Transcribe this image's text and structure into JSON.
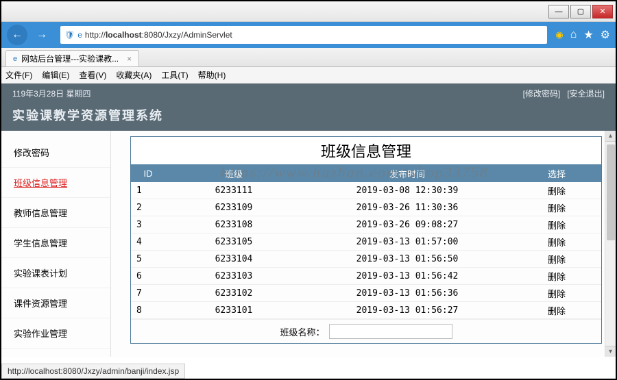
{
  "window": {
    "min": "—",
    "max": "▢",
    "close": "✕"
  },
  "nav": {
    "back": "←",
    "fwd": "→",
    "url_prefix": "http://",
    "url_host": "localhost",
    "url_rest": ":8080/Jxzy/AdminServlet"
  },
  "tab": {
    "title": "网站后台管理---实验课教..."
  },
  "menu": [
    "文件(F)",
    "编辑(E)",
    "查看(V)",
    "收藏夹(A)",
    "工具(T)",
    "帮助(H)"
  ],
  "header": {
    "date": "119年3月28日 星期四",
    "link_pwd": "[修改密码]",
    "link_exit": "[安全退出]",
    "title": "实验课教学资源管理系统"
  },
  "sidebar": {
    "items": [
      {
        "label": "修改密码",
        "active": false
      },
      {
        "label": "班级信息管理",
        "active": true
      },
      {
        "label": "教师信息管理",
        "active": false
      },
      {
        "label": "学生信息管理",
        "active": false
      },
      {
        "label": "实验课表计划",
        "active": false
      },
      {
        "label": "课件资源管理",
        "active": false
      },
      {
        "label": "实验作业管理",
        "active": false
      }
    ]
  },
  "panel": {
    "title": "班级信息管理",
    "columns": {
      "id": "ID",
      "class": "班级",
      "time": "发布时间",
      "action": "选择"
    },
    "rows": [
      {
        "id": "1",
        "class": "6233111",
        "time": "2019-03-08 12:30:39",
        "action": "删除"
      },
      {
        "id": "2",
        "class": "6233109",
        "time": "2019-03-26 11:30:36",
        "action": "删除"
      },
      {
        "id": "3",
        "class": "6233108",
        "time": "2019-03-26 09:08:27",
        "action": "删除"
      },
      {
        "id": "4",
        "class": "6233105",
        "time": "2019-03-13 01:57:00",
        "action": "删除"
      },
      {
        "id": "5",
        "class": "6233104",
        "time": "2019-03-13 01:56:50",
        "action": "删除"
      },
      {
        "id": "6",
        "class": "6233103",
        "time": "2019-03-13 01:56:42",
        "action": "删除"
      },
      {
        "id": "7",
        "class": "6233102",
        "time": "2019-03-13 01:56:36",
        "action": "删除"
      },
      {
        "id": "8",
        "class": "6233101",
        "time": "2019-03-13 01:56:27",
        "action": "删除"
      }
    ],
    "form_label": "班级名称："
  },
  "watermark": "https://www.huzhan.com/ishop33758",
  "statusbar": "http://localhost:8080/Jxzy/admin/banji/index.jsp"
}
